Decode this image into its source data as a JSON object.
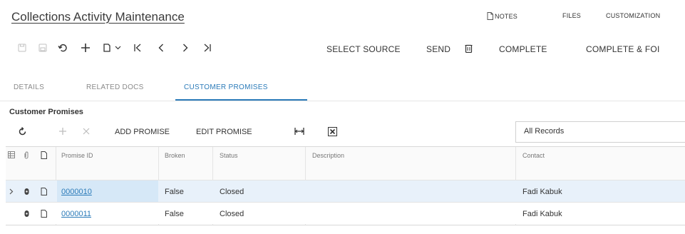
{
  "header": {
    "title": "Collections Activity Maintenance",
    "links": {
      "notes": "NOTES",
      "files": "FILES",
      "customization": "CUSTOMIZATION"
    }
  },
  "toolbar": {
    "icons": [
      "save-icon",
      "save-close-icon",
      "undo-icon",
      "add-icon",
      "copy-icon",
      "chevron-down-icon",
      "first-icon",
      "previous-icon",
      "next-icon",
      "last-icon",
      "delete-icon"
    ],
    "select_source": "SELECT SOURCE",
    "send": "SEND",
    "complete": "COMPLETE",
    "complete_follow": "COMPLETE & FOI"
  },
  "tabs": [
    {
      "label": "DETAILS",
      "active": false
    },
    {
      "label": "RELATED DOCS",
      "active": false
    },
    {
      "label": "CUSTOMER PROMISES",
      "active": true
    }
  ],
  "grid": {
    "section_title": "Customer Promises",
    "toolbar": {
      "add_promise": "ADD PROMISE",
      "edit_promise": "EDIT PROMISE",
      "filter_value": "All Records"
    },
    "columns": [
      "Promise ID",
      "Broken",
      "Status",
      "Description",
      "Contact"
    ],
    "rows": [
      {
        "promise_id": "0000010",
        "broken": "False",
        "status": "Closed",
        "description": "",
        "contact": "Fadi Kabuk",
        "selected": true
      },
      {
        "promise_id": "0000011",
        "broken": "False",
        "status": "Closed",
        "description": "",
        "contact": "Fadi Kabuk",
        "selected": false
      }
    ]
  },
  "colors": {
    "accent": "#2b7bb9",
    "row_selected": "#e8f1fa",
    "cell_selected": "#d6e8f7"
  }
}
